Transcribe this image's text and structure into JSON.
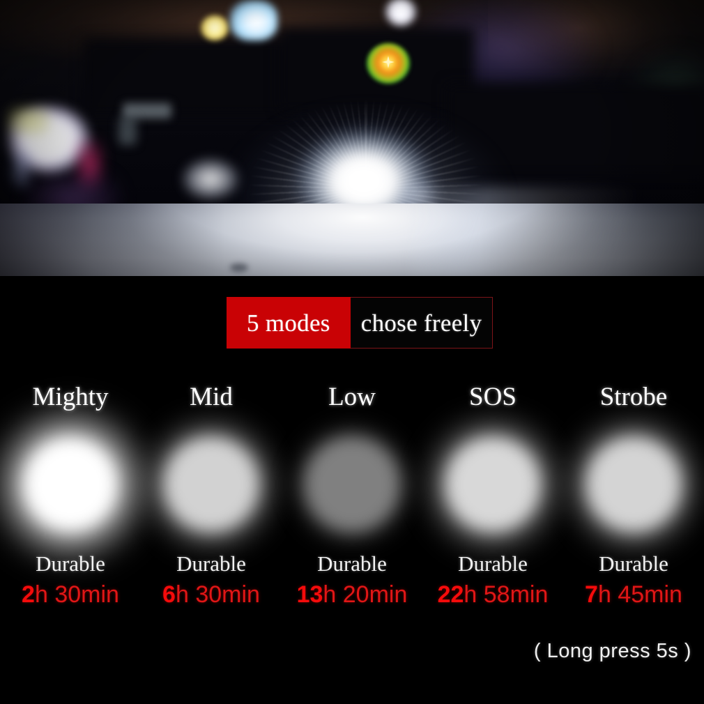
{
  "photo": {
    "alt": "blurred night street scene with bright flashlight beam starburst",
    "lights": {
      "traffic_signal": "green-amber-traffic-light",
      "headlight": "headlight-starburst",
      "storefront": "illuminated-storefront-sign"
    }
  },
  "banner": {
    "highlight_text": "5 modes",
    "rest_text": "chose freely",
    "highlight_bg": "#c90205",
    "rest_bg": "#040404",
    "border_color": "#7d1418"
  },
  "modes": [
    {
      "name": "Mighty",
      "durable_label": "Durable",
      "time_number": "2",
      "time_unit": "h 30min",
      "time_full": "2h 30min",
      "brightness_color": "#ffffff",
      "brightness_level": 100
    },
    {
      "name": "Mid",
      "durable_label": "Durable",
      "time_number": "6",
      "time_unit": "h 30min",
      "time_full": "6h 30min",
      "brightness_color": "#d2d2d2",
      "brightness_level": 70
    },
    {
      "name": "Low",
      "durable_label": "Durable",
      "time_number": "13",
      "time_unit": "h 20min",
      "time_full": "13h 20min",
      "brightness_color": "#808080",
      "brightness_level": 40
    },
    {
      "name": "SOS",
      "durable_label": "Durable",
      "time_number": "22",
      "time_unit": "h 58min",
      "time_full": "22h 58min",
      "brightness_color": "#d8d8d8",
      "brightness_level": 75
    },
    {
      "name": "Strobe",
      "durable_label": "Durable",
      "time_number": "7",
      "time_unit": "h 45min",
      "time_full": "7h 45min",
      "brightness_color": "#d4d4d4",
      "brightness_level": 72
    }
  ],
  "footnote": {
    "text": "( Long press 5s )"
  },
  "colors": {
    "background": "#000000",
    "accent_red": "#c90205",
    "time_red": "#ee1111",
    "text_white": "#ffffff"
  }
}
